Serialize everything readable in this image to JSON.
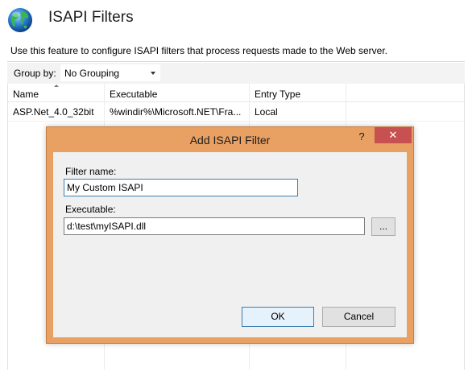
{
  "header": {
    "title": "ISAPI Filters",
    "description": "Use this feature to configure ISAPI filters that process requests made to the Web server."
  },
  "toolbar": {
    "group_by_label": "Group by:",
    "group_by_value": "No Grouping"
  },
  "grid": {
    "columns": [
      "Name",
      "Executable",
      "Entry Type"
    ],
    "rows": [
      {
        "name": "ASP.Net_4.0_32bit",
        "executable": "%windir%\\Microsoft.NET\\Fra...",
        "entry_type": "Local"
      }
    ]
  },
  "dialog": {
    "title": "Add ISAPI Filter",
    "help_label": "?",
    "close_label": "✕",
    "filter_name_label": "Filter name:",
    "filter_name_value": "My Custom ISAPI",
    "executable_label": "Executable:",
    "executable_value": "d:\\test\\myISAPI.dll",
    "browse_label": "...",
    "ok_label": "OK",
    "cancel_label": "Cancel"
  },
  "colors": {
    "dialog_frame": "#e8a063",
    "close_button": "#c75050",
    "dialog_body": "#f0f0f0"
  },
  "icons": {
    "header_icon": "globe-icon"
  }
}
